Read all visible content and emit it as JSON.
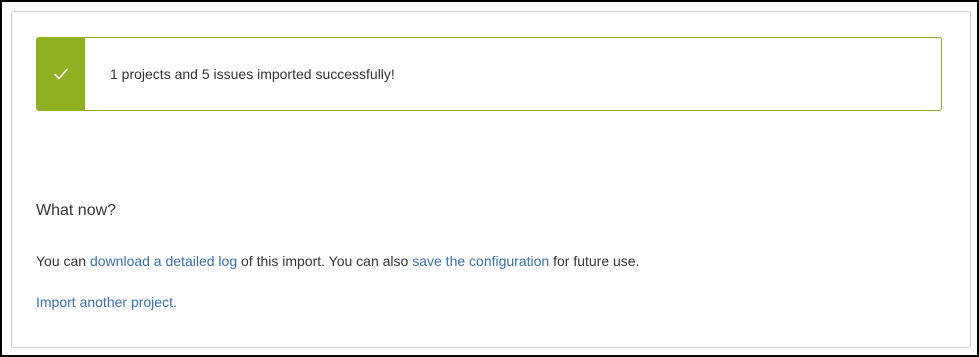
{
  "alert": {
    "icon": "check-icon",
    "message": "1 projects and 5 issues imported successfully!",
    "color": "#8eb021"
  },
  "what_now": {
    "heading": "What now?",
    "sentence": {
      "part1": "You can ",
      "download_link": "download a detailed log",
      "part2": " of this import. You can also ",
      "save_link": "save the configuration",
      "part3": " for future use."
    },
    "import_another_link": "Import another project."
  },
  "colors": {
    "link": "#3572b0",
    "text": "#333333",
    "success": "#8eb021"
  }
}
